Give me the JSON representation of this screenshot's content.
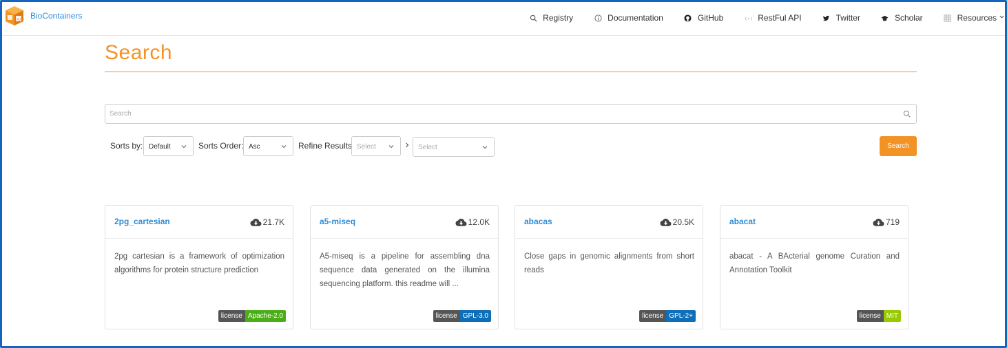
{
  "navbar": {
    "brand": "BioContainers",
    "links": [
      {
        "label": "Registry",
        "icon": "search-icon"
      },
      {
        "label": "Documentation",
        "icon": "info-icon"
      },
      {
        "label": "GitHub",
        "icon": "github-icon"
      },
      {
        "label": "RestFul API",
        "icon": "api-icon"
      },
      {
        "label": "Twitter",
        "icon": "twitter-icon"
      },
      {
        "label": "Scholar",
        "icon": "graduation-cap-icon"
      },
      {
        "label": "Resources",
        "icon": "grid-icon",
        "dropdown": true
      }
    ]
  },
  "page": {
    "title": "Search"
  },
  "search": {
    "placeholder": "Search",
    "value": "",
    "button_label": "Search"
  },
  "filters": {
    "sort_by": {
      "label": "Sorts by:",
      "value": "Default"
    },
    "sort_order": {
      "label": "Sorts Order:",
      "value": "Asc"
    },
    "refine": {
      "label": "Refine Results:",
      "first_placeholder": "Select",
      "second_placeholder": "Select"
    }
  },
  "cards": [
    {
      "name": "2pg_cartesian",
      "downloads": "21.7K",
      "description": "2pg cartesian is a framework of optimization algorithms for protein structure prediction",
      "license_key": "license",
      "license": "Apache-2.0",
      "license_color": "#4cae17"
    },
    {
      "name": "a5-miseq",
      "downloads": "12.0K",
      "description": "A5-miseq is a pipeline for assembling dna sequence data generated on the illumina sequencing platform. this readme will ...",
      "license_key": "license",
      "license": "GPL-3.0",
      "license_color": "#0e6eb8"
    },
    {
      "name": "abacas",
      "downloads": "20.5K",
      "description": "Close gaps in genomic alignments from short reads",
      "license_key": "license",
      "license": "GPL-2+",
      "license_color": "#0e6eb8"
    },
    {
      "name": "abacat",
      "downloads": "719",
      "description": "abacat - A BActerial genome Curation and Annotation Toolkit",
      "license_key": "license",
      "license": "MIT",
      "license_color": "#97ca00"
    }
  ],
  "colors": {
    "accent": "#f39325",
    "link": "#2d8cd6",
    "frame": "#1565c0"
  }
}
